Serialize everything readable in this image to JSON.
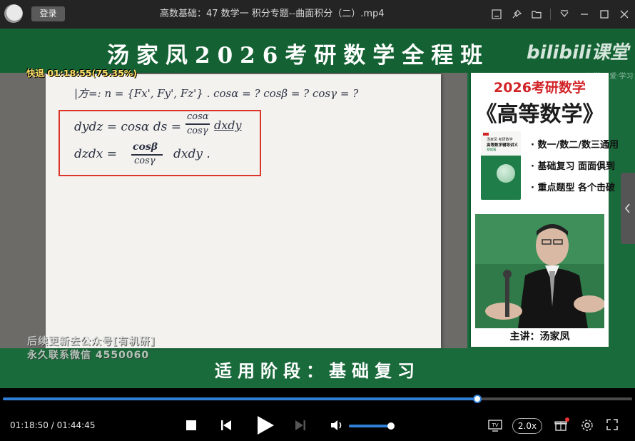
{
  "titlebar": {
    "login_label": "登录",
    "title": "高数基础：47 数学一 积分专题--曲面积分（二）.mp4",
    "icons": [
      "screenshot-icon",
      "pin-icon",
      "folder-icon",
      "menu-icon",
      "minimize-icon",
      "maximize-icon",
      "close-icon"
    ]
  },
  "video": {
    "course_title": "汤家凤2026考研数学全程班",
    "brand": "bilibili课堂",
    "brand_sub": "一·心学习 爱·学习",
    "speed_overlay": "快退 01:18:55(75.35%)",
    "board": {
      "line1": "|方=: n = {Fx', Fy', Fz'} . cosα = ? cosβ = ? cosγ = ?",
      "line2a": "dydz = cosα ds =",
      "line2_num": "cosα",
      "line2_den": "cosγ",
      "line2b": "dxdy",
      "line3a": "dzdx =",
      "line3_num": "cosβ",
      "line3_den": "cosγ",
      "line3b": "dxdy ."
    },
    "watermark1": "后续更新去公众号[有机研]",
    "watermark2": "永久联系微信 4550060",
    "panel": {
      "title1": "2026考研数学",
      "title2": "《高等数学》",
      "book_t1": "汤家凤 考研数学",
      "book_t2": "高等数学辅导讲义",
      "book_t3": "基础篇",
      "bullets": [
        "· 数一/数二/数三通用",
        "· 基础复习 面面俱到",
        "· 重点题型 各个击破"
      ],
      "teacher_label": "主讲：汤家凤"
    },
    "stage_text": "适用阶段：基础复习"
  },
  "player": {
    "progress_fraction": 0.7535,
    "current_time": "01:18:50",
    "separator": " / ",
    "total_time": "01:44:45",
    "volume_fraction": 0.95,
    "speed_label": "2.0x",
    "accent_color": "#2f7fd6"
  }
}
